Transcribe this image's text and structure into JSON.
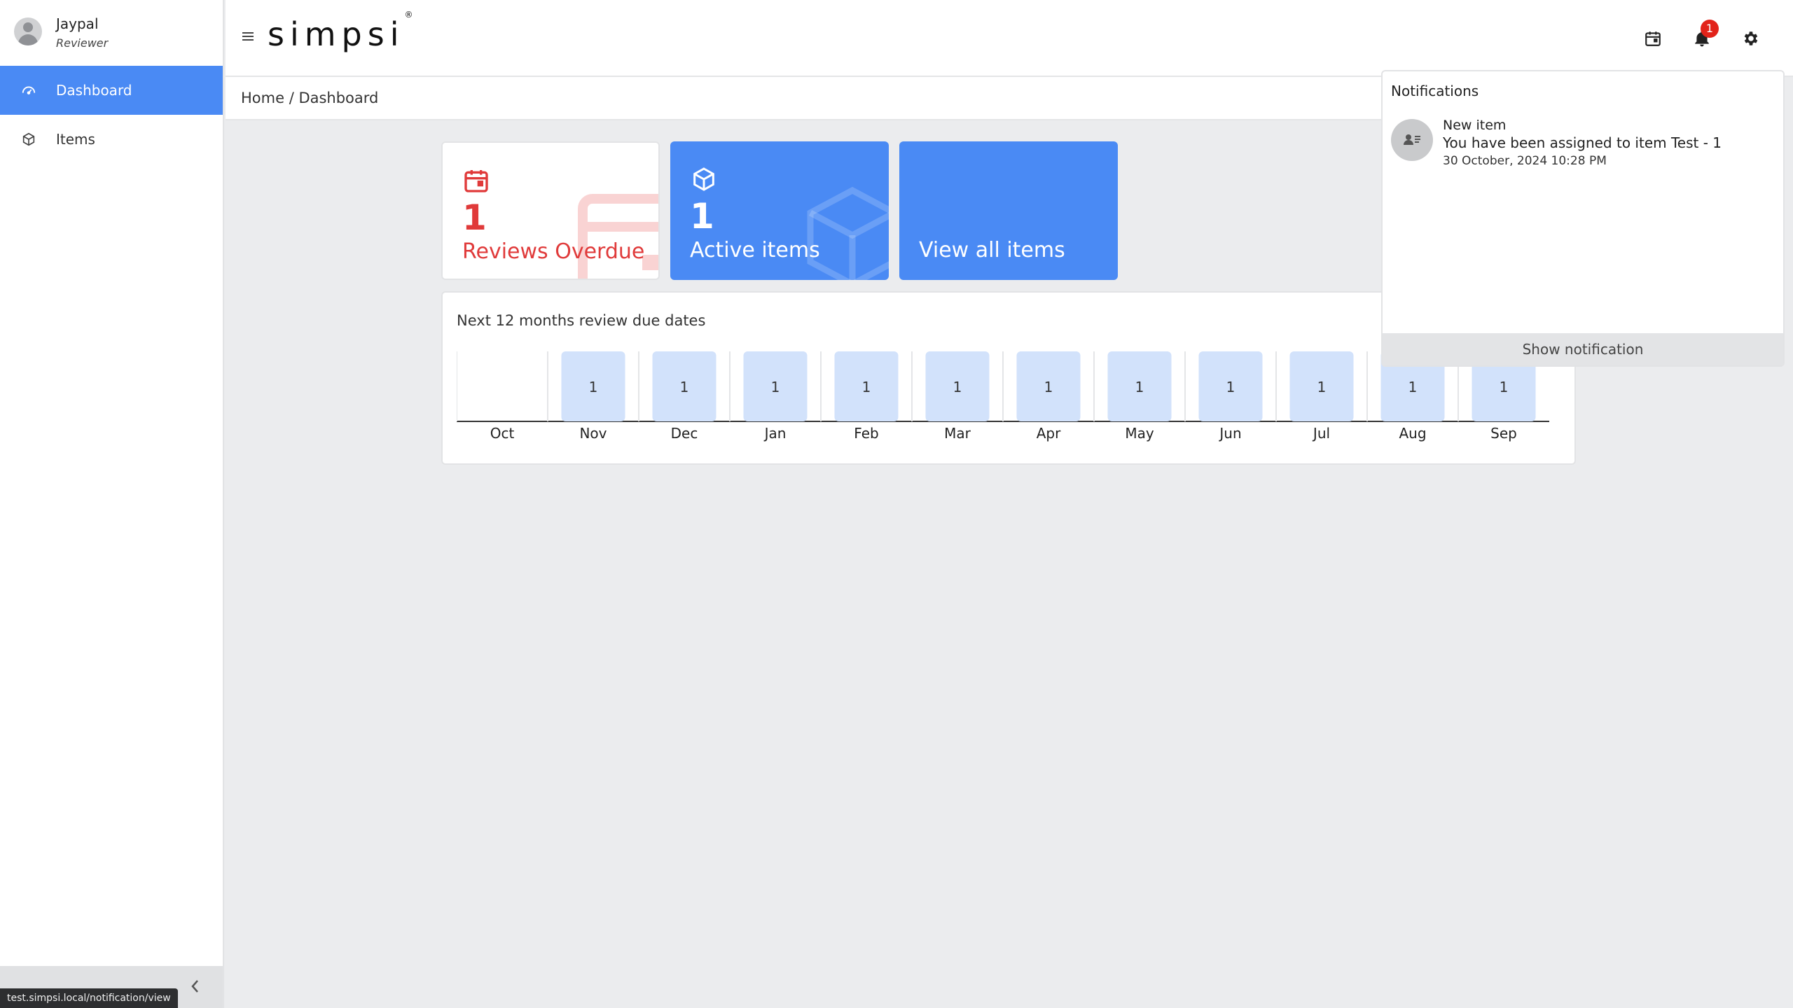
{
  "user": {
    "name": "Jaypal",
    "role": "Reviewer"
  },
  "sidebar": {
    "items": [
      {
        "label": "Dashboard",
        "icon": "dashboard-icon",
        "active": true
      },
      {
        "label": "Items",
        "icon": "cube-icon",
        "active": false
      }
    ]
  },
  "statusbar": {
    "url": "test.simpsi.local/notification/view"
  },
  "topbar": {
    "logo": "simpsi",
    "logo_mark": "®",
    "notification_count": "1"
  },
  "breadcrumb": "Home / Dashboard",
  "cards": {
    "overdue": {
      "value": "1",
      "label": "Reviews Overdue"
    },
    "active": {
      "value": "1",
      "label": "Active items"
    },
    "all": {
      "label": "View all items"
    }
  },
  "panel": {
    "title": "Next 12 months review due dates"
  },
  "chart_data": {
    "type": "bar",
    "categories": [
      "Oct",
      "Nov",
      "Dec",
      "Jan",
      "Feb",
      "Mar",
      "Apr",
      "May",
      "Jun",
      "Jul",
      "Aug",
      "Sep"
    ],
    "values": [
      0,
      1,
      1,
      1,
      1,
      1,
      1,
      1,
      1,
      1,
      1,
      1
    ],
    "value_labels": [
      "",
      "1",
      "1",
      "1",
      "1",
      "1",
      "1",
      "1",
      "1",
      "1",
      "1",
      "1"
    ],
    "bar_color": "#d2e2fb",
    "ylim": [
      0,
      1
    ]
  },
  "notifications": {
    "heading": "Notifications",
    "items": [
      {
        "title": "New item",
        "message": "You have been assigned to item Test - 1",
        "time": "30 October, 2024 10:28 PM"
      }
    ],
    "footer": "Show notification"
  },
  "colors": {
    "primary": "#4a8af4",
    "danger": "#e03a3a",
    "badge": "#e2231a"
  }
}
